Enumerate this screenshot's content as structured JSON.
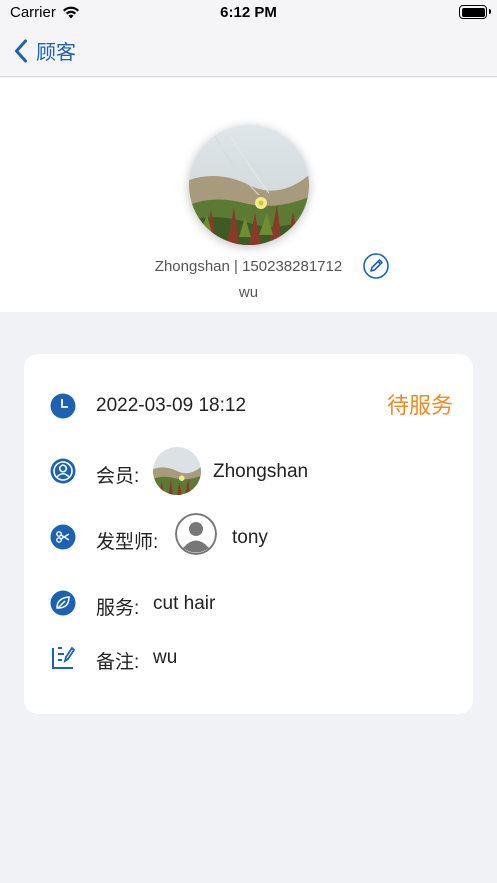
{
  "status_bar": {
    "carrier": "Carrier",
    "time": "6:12 PM"
  },
  "nav": {
    "back_label": "顾客"
  },
  "profile": {
    "info": "Zhongshan | 150238281712",
    "note": "wu"
  },
  "order": {
    "datetime": "2022-03-09 18:12",
    "status": "待服务",
    "member_label": "会员:",
    "member_name": "Zhongshan",
    "stylist_label": "发型师:",
    "stylist_name": "tony",
    "service_label": "服务:",
    "service_value": "cut hair",
    "remark_label": "备注:",
    "remark_value": "wu"
  },
  "colors": {
    "accent": "#1d62b2",
    "status": "#f08a24",
    "background": "#f1f2f5"
  },
  "icons": [
    "wifi-icon",
    "battery-icon",
    "chevron-left-icon",
    "edit-icon",
    "clock-icon",
    "user-icon",
    "scissors-icon",
    "leaf-icon",
    "note-icon",
    "default-avatar-icon"
  ]
}
